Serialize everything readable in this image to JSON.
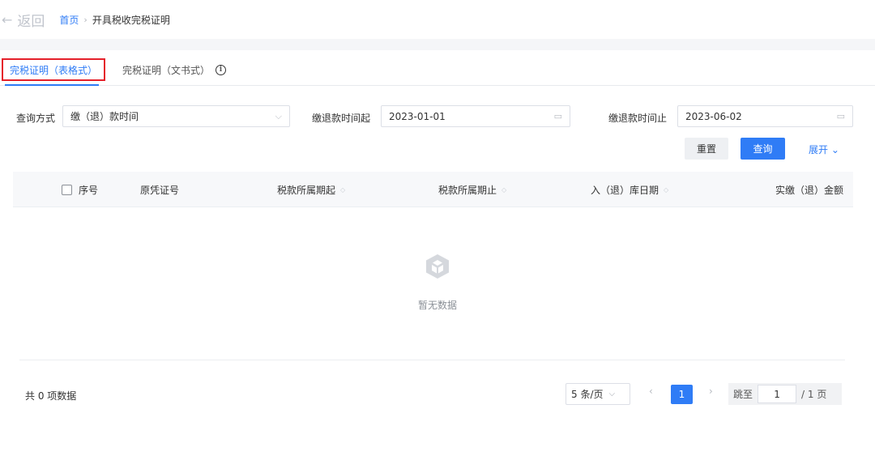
{
  "nav": {
    "back_label": "返回",
    "home": "首页",
    "current": "开具税收完税证明"
  },
  "tabs": [
    {
      "label": "完税证明（表格式）",
      "active": true
    },
    {
      "label": "完税证明（文书式）",
      "active": false
    }
  ],
  "filters": {
    "query_method_label": "查询方式",
    "query_method_value": "缴（退）款时间",
    "start_label": "缴退款时间起",
    "start_value": "2023-01-01",
    "end_label": "缴退款时间止",
    "end_value": "2023-06-02"
  },
  "buttons": {
    "reset": "重置",
    "query": "查询",
    "expand": "展开"
  },
  "table": {
    "columns": [
      "序号",
      "原凭证号",
      "税款所属期起",
      "税款所属期止",
      "入（退）库日期",
      "实缴（退）金额"
    ],
    "rows": [],
    "empty_text": "暂无数据"
  },
  "pagination": {
    "total_text": "共 0 项数据",
    "page_size": "5 条/页",
    "current_page": "1",
    "jump_label": "跳至",
    "jump_value": "1",
    "page_suffix": "/ 1 页"
  },
  "colors": {
    "primary": "#2f7cf6",
    "highlight_border": "#e5202a"
  }
}
